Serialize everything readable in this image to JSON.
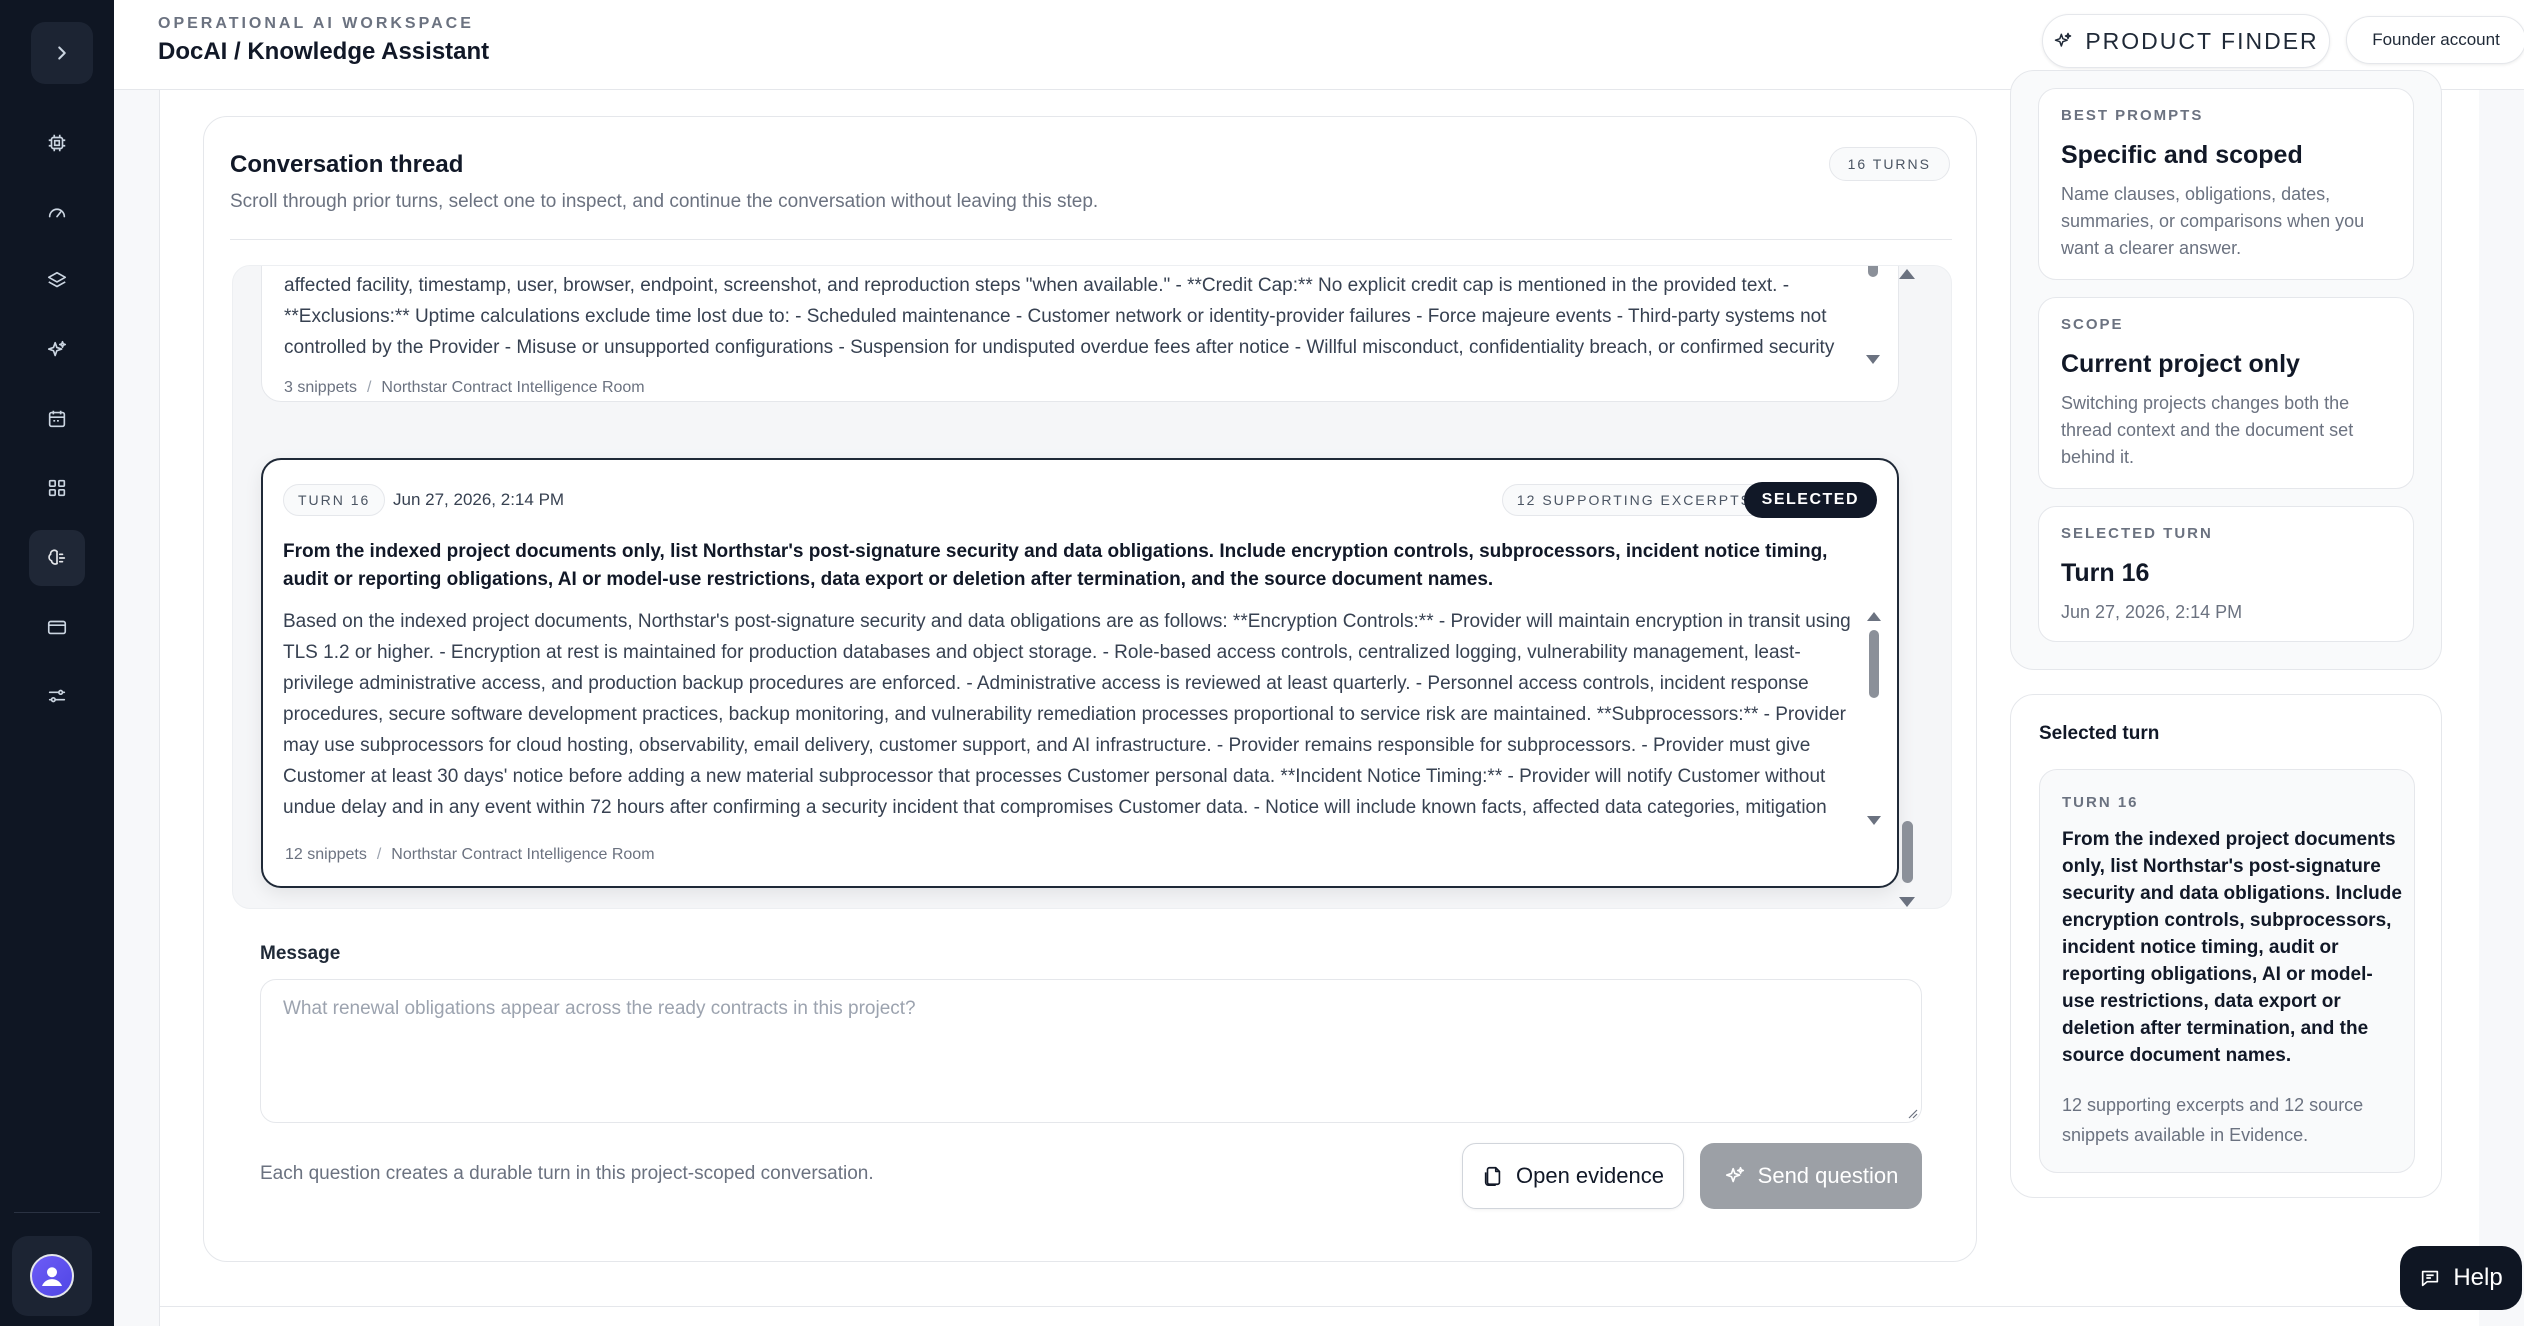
{
  "header": {
    "kicker": "OPERATIONAL AI WORKSPACE",
    "title": "DocAI / Knowledge Assistant",
    "product_finder": "PRODUCT FINDER",
    "account": "Founder account"
  },
  "thread": {
    "title": "Conversation thread",
    "subtitle": "Scroll through prior turns, select one to inspect, and continue the conversation without leaving this step.",
    "turns_badge": "16 TURNS",
    "prior_turn": {
      "body": "commitments. - **Claim Deadline:** The Customer must submit support requests through the support portal or designated emergency email, including detailed information such as affected facility, timestamp, user, browser, endpoint, screenshot, and reproduction steps \"when available.\" - **Credit Cap:** No explicit credit cap is mentioned in the provided text. - **Exclusions:** Uptime calculations exclude time lost due to: - Scheduled maintenance - Customer network or identity-provider failures - Force majeure events - Third-party systems not controlled by the Provider - Misuse or unsupported configurations - Suspension for undisputed overdue fees after notice - Willful misconduct, confidentiality breach, or confirmed security",
      "snippets": "3 snippets",
      "room": "Northstar Contract Intelligence Room"
    },
    "selected_turn": {
      "turn_label": "TURN 16",
      "date": "Jun 27, 2026, 2:14 PM",
      "excerpts_badge": "12 SUPPORTING EXCERPTS",
      "selected_badge": "SELECTED",
      "question": "From the indexed project documents only, list Northstar's post-signature security and data obligations. Include encryption controls, subprocessors, incident notice timing, audit or reporting obligations, AI or model-use restrictions, data export or deletion after termination, and the source document names.",
      "answer": "Based on the indexed project documents, Northstar's post-signature security and data obligations are as follows: **Encryption Controls:** - Provider will maintain encryption in transit using TLS 1.2 or higher. - Encryption at rest is maintained for production databases and object storage. - Role-based access controls, centralized logging, vulnerability management, least-privilege administrative access, and production backup procedures are enforced. - Administrative access is reviewed at least quarterly. - Personnel access controls, incident response procedures, secure software development practices, backup monitoring, and vulnerability remediation processes proportional to service risk are maintained. **Subprocessors:** - Provider may use subprocessors for cloud hosting, observability, email delivery, customer support, and AI infrastructure. - Provider remains responsible for subprocessors. - Provider must give Customer at least 30 days' notice before adding a new material subprocessor that processes Customer personal data. **Incident Notice Timing:** - Provider will notify Customer without undue delay and in any event within 72 hours after confirming a security incident that compromises Customer data. - Notice will include known facts, affected data categories, mitigation",
      "snippets": "12 snippets",
      "room": "Northstar Contract Intelligence Room"
    }
  },
  "composer": {
    "label": "Message",
    "placeholder": "What renewal obligations appear across the ready contracts in this project?",
    "value": "",
    "note": "Each question creates a durable turn in this project-scoped conversation.",
    "open_evidence": "Open evidence",
    "send": "Send question"
  },
  "rail": {
    "best_prompts": {
      "kicker": "BEST PROMPTS",
      "title": "Specific and scoped",
      "text": "Name clauses, obligations, dates, summaries, or comparisons when you want a clearer answer."
    },
    "scope": {
      "kicker": "SCOPE",
      "title": "Current project only",
      "text": "Switching projects changes both the thread context and the document set behind it."
    },
    "selected_turn": {
      "kicker": "SELECTED TURN",
      "title": "Turn 16",
      "text": "Jun 27, 2026, 2:14 PM"
    },
    "selected_detail": {
      "title": "Selected turn",
      "kicker": "TURN 16",
      "question": "From the indexed project documents only, list Northstar's post-signature security and data obligations. Include encryption controls, subprocessors, incident notice timing, audit or reporting obligations, AI or model-use restrictions, data export or deletion after termination, and the source document names.",
      "note": "12 supporting excerpts and 12 source snippets available in Evidence."
    }
  },
  "help": {
    "label": "Help"
  },
  "icons": {
    "sidebar": [
      "chevron-right-icon",
      "cpu-icon",
      "gauge-icon",
      "layers-icon",
      "sparkles-icon",
      "calendar-icon",
      "grid-icon",
      "brain-icon",
      "card-icon",
      "sliders-icon",
      "user-avatar-icon"
    ]
  }
}
